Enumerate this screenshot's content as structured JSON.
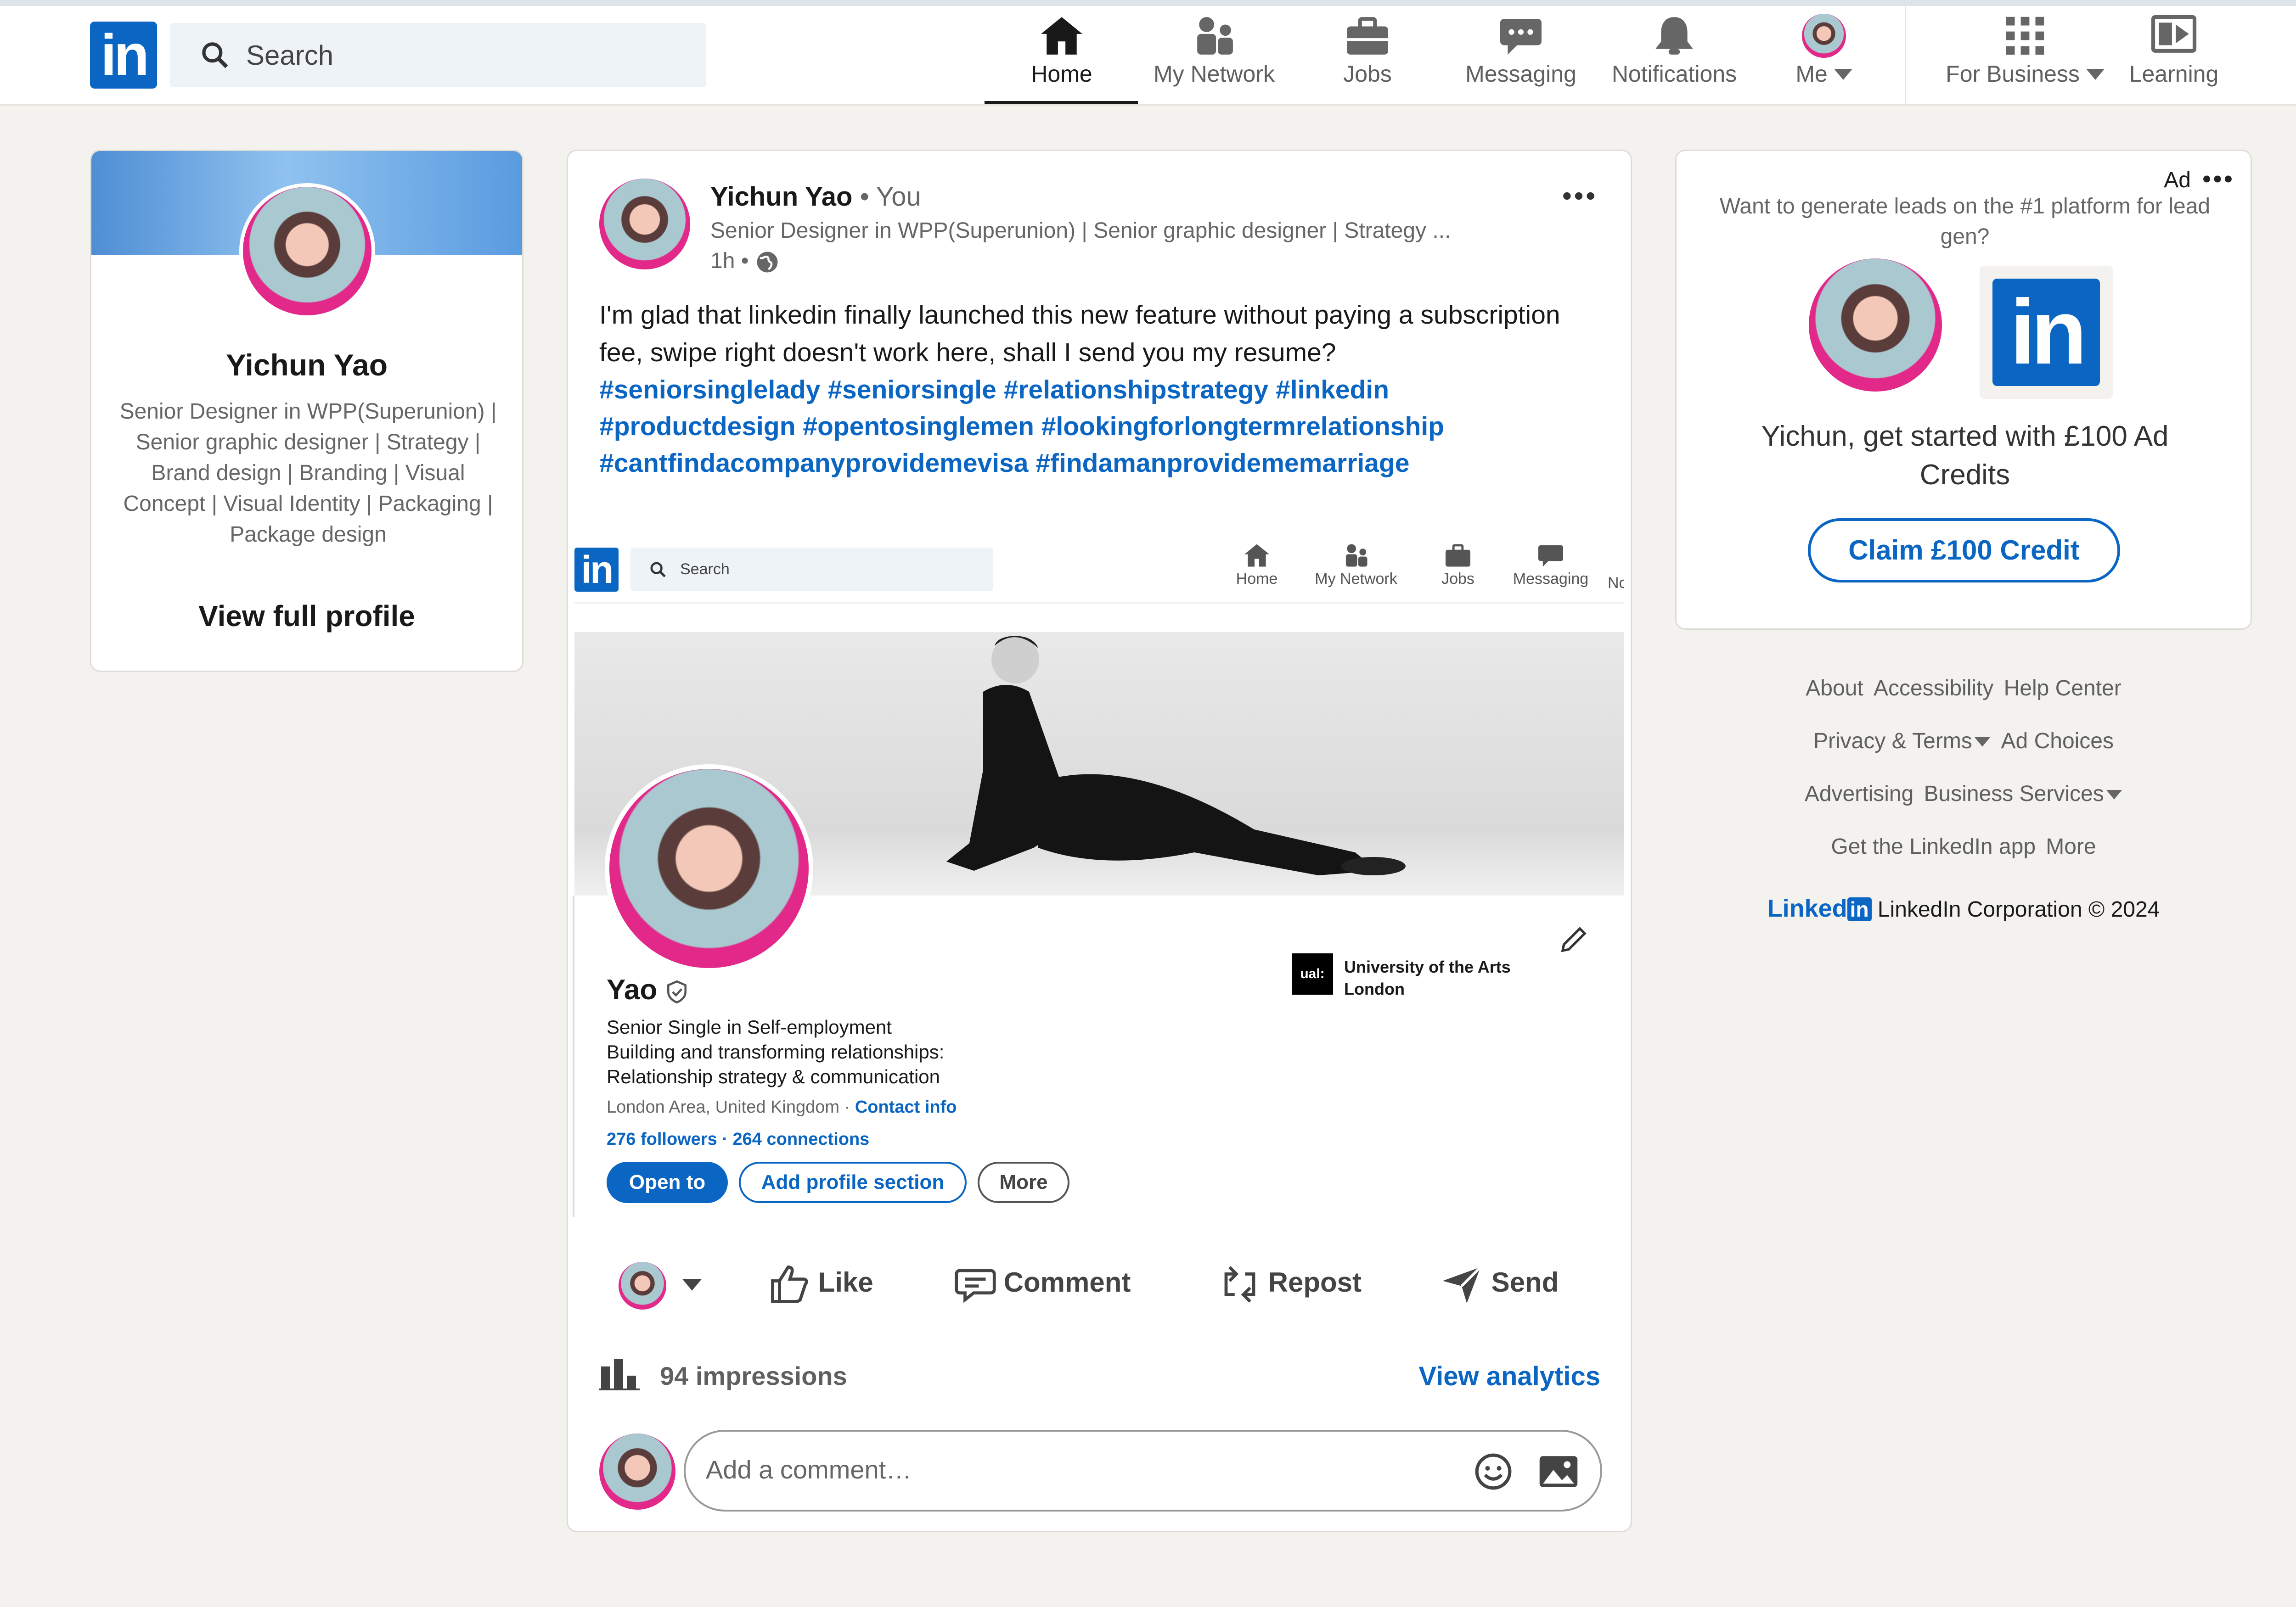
{
  "nav": {
    "search_placeholder": "Search",
    "items": [
      {
        "label": "Home"
      },
      {
        "label": "My Network"
      },
      {
        "label": "Jobs"
      },
      {
        "label": "Messaging"
      },
      {
        "label": "Notifications"
      },
      {
        "label": "Me"
      },
      {
        "label": "For Business"
      },
      {
        "label": "Learning"
      }
    ]
  },
  "profile_card": {
    "name": "Yichun Yao",
    "headline": "Senior Designer in WPP(Superunion) | Senior graphic designer | Strategy | Brand design | Branding | Visual Concept | Visual Identity | Packaging | Package design",
    "view_profile": "View full profile"
  },
  "post": {
    "author": "Yichun Yao",
    "you": "• You",
    "author_headline": "Senior Designer in WPP(Superunion) | Senior graphic designer | Strategy ...",
    "time": "1h •",
    "text": "I'm glad that linkedin finally launched this new feature without paying a subscription fee, swipe right doesn't work here, shall I send you my resume?",
    "hashtags_line1": "#seniorsinglelady #seniorsingle #relationshipstrategy #linkedin",
    "hashtags_line2": "#productdesign #opentosinglemen #lookingforlongtermrelationship",
    "hashtags_line3": "#cantfindacompanyprovidemevisa #findamanprovidememarriage",
    "actions": {
      "like": "Like",
      "comment": "Comment",
      "repost": "Repost",
      "send": "Send"
    },
    "impressions": "94 impressions",
    "view_analytics": "View analytics",
    "comment_placeholder": "Add a comment…"
  },
  "embedded": {
    "search": "Search",
    "nav": [
      "Home",
      "My Network",
      "Jobs",
      "Messaging",
      "No"
    ],
    "name": "Yao",
    "headline_line1": "Senior Single in Self-employment",
    "headline_line2": "Building and transforming relationships:",
    "headline_line3": "Relationship strategy & communication",
    "location": "London Area, United Kingdom ·",
    "contact_info": "Contact info",
    "followers": "276 followers",
    "connections": "· 264 connections",
    "school_logo": "ual:",
    "school_line1": "University of the Arts",
    "school_line2": "London",
    "btn_open": "Open to",
    "btn_add": "Add profile section",
    "btn_more": "More"
  },
  "ad": {
    "ad_label": "Ad",
    "prompt": "Want to generate leads on the #1 platform for lead gen?",
    "headline": "Yichun, get started with £100 Ad Credits",
    "cta": "Claim £100 Credit"
  },
  "footer": {
    "links_row1": [
      "About",
      "Accessibility",
      "Help Center"
    ],
    "links_row2": [
      "Privacy & Terms",
      "Ad Choices"
    ],
    "links_row3": [
      "Advertising",
      "Business Services"
    ],
    "links_row4": [
      "Get the LinkedIn app",
      "More"
    ],
    "brand": "Linked",
    "brand_in": "in",
    "copyright": "LinkedIn Corporation © 2024"
  },
  "colors": {
    "brand": "#0a66c2",
    "background": "#f4f2ee",
    "badge": "#e2298a"
  }
}
